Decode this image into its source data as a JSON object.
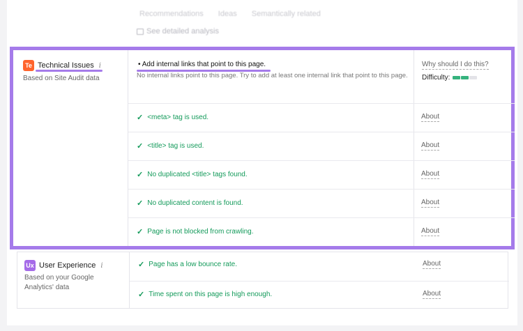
{
  "top": {
    "faded_tabs": [
      "Recommendations",
      "Ideas",
      "Semantically related"
    ],
    "see_analysis_label": "See detailed analysis"
  },
  "technical": {
    "badge": "Te",
    "badge_color": "#ff642d",
    "title": "Technical Issues",
    "subtitle": "Based on Site Audit data",
    "issue_title": "Add internal links that point to this page.",
    "issue_desc": "No internal links point to this page. Try to add at least one internal link that point to this page.",
    "why_label": "Why should I do this?",
    "difficulty_label": "Difficulty:",
    "difficulty_level": 0.6,
    "checks": [
      "<meta> tag is used.",
      "<title> tag is used.",
      "No duplicated <title> tags found.",
      "No duplicated content is found.",
      "Page is not blocked from crawling."
    ],
    "about_label": "About"
  },
  "ux": {
    "badge": "Ux",
    "badge_color": "#a56be8",
    "title": "User Experience",
    "subtitle": "Based on your Google Analytics' data",
    "checks": [
      "Page has a low bounce rate.",
      "Time spent on this page is high enough."
    ],
    "about_label": "About"
  },
  "accent_color": "#a57bea",
  "success_color": "#139a5a"
}
